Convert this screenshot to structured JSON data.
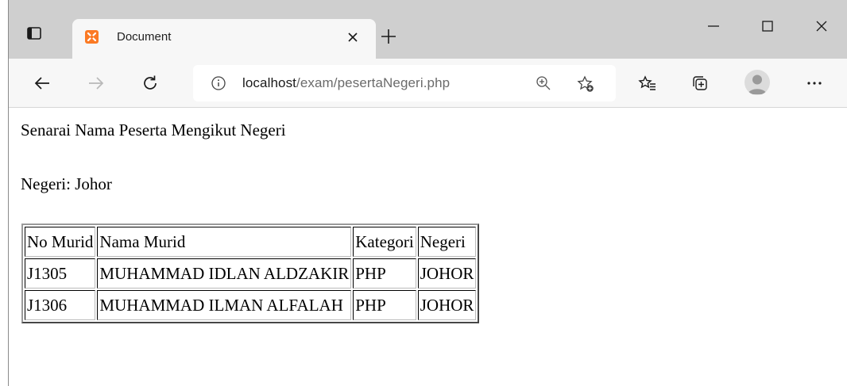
{
  "browser": {
    "tab": {
      "title": "Document"
    },
    "address": {
      "host": "localhost",
      "path": "/exam/pesertaNegeri.php"
    }
  },
  "page": {
    "heading": "Senarai Nama Peserta Mengikut Negeri",
    "state_line": "Negeri: Johor",
    "table": {
      "headers": [
        "No Murid",
        "Nama Murid",
        "Kategori",
        "Negeri"
      ],
      "rows": [
        [
          "J1305",
          "MUHAMMAD IDLAN ALDZAKIR",
          "PHP",
          "JOHOR"
        ],
        [
          "J1306",
          "MUHAMMAD ILMAN ALFALAH",
          "PHP",
          "JOHOR"
        ]
      ]
    }
  },
  "colors": {
    "favicon": "#fb7a24",
    "tabstrip": "#cfcfcf",
    "toolbar": "#f7f7f7"
  },
  "icons": [
    "tab-actions-icon",
    "xampp-favicon-icon",
    "close-tab-icon",
    "new-tab-icon",
    "minimize-icon",
    "maximize-icon",
    "close-window-icon",
    "back-icon",
    "forward-icon",
    "refresh-icon",
    "site-info-icon",
    "zoom-icon",
    "add-favorite-icon",
    "favorites-icon",
    "collections-icon",
    "profile-avatar-icon",
    "more-menu-icon"
  ]
}
